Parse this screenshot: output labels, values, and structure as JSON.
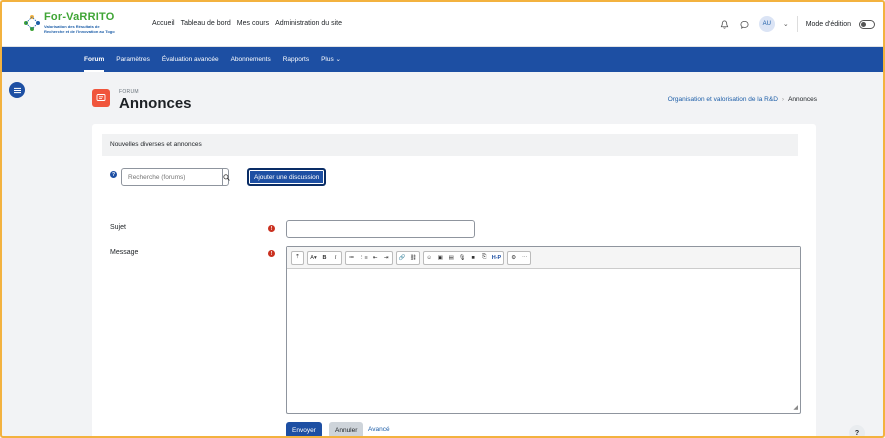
{
  "logo": {
    "title": "For-VaRRITO",
    "sub1": "Valorisation des Résultats de",
    "sub2": "Recherche et de l'Innovation au Togo"
  },
  "primary_nav": [
    "Accueil",
    "Tableau de bord",
    "Mes cours",
    "Administration du site"
  ],
  "user": {
    "initials": "AU",
    "edit_mode_label": "Mode d'édition"
  },
  "secondary_nav": [
    "Forum",
    "Paramètres",
    "Évaluation avancée",
    "Abonnements",
    "Rapports",
    "Plus ⌄"
  ],
  "header": {
    "small": "FORUM",
    "title": "Annonces"
  },
  "breadcrumb": {
    "parent": "Organisation et valorisation de la R&D",
    "current": "Annonces"
  },
  "intro": "Nouvelles diverses et annonces",
  "search": {
    "placeholder": "Recherche (forums)"
  },
  "add_discussion": "Ajouter une discussion",
  "form": {
    "subject_label": "Sujet",
    "message_label": "Message"
  },
  "toolbar": {
    "g1": [
      "⤒"
    ],
    "g2": [
      "A▾",
      "B",
      "I"
    ],
    "g3": [
      "≔",
      "⋮≡",
      "⇤",
      "⇥"
    ],
    "g4": [
      "🔗",
      "⛓"
    ],
    "g5": [
      "☺",
      "▣",
      "▤",
      "🎙",
      "■",
      "⎘",
      "H-P"
    ],
    "g6": [
      "⚙",
      "⋯"
    ]
  },
  "buttons": {
    "send": "Envoyer",
    "cancel": "Annuler",
    "advanced": "Avancé"
  },
  "help_fab": "?"
}
